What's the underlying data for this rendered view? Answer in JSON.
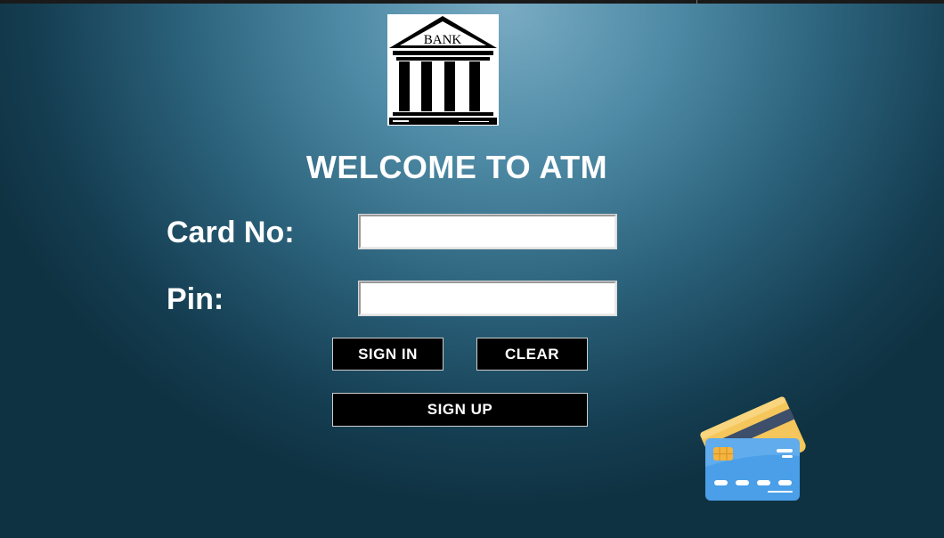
{
  "logo": {
    "text": "BANK"
  },
  "title": "WELCOME TO ATM",
  "form": {
    "card_label": "Card No:",
    "card_value": "",
    "pin_label": "Pin:",
    "pin_value": ""
  },
  "buttons": {
    "sign_in": "SIGN IN",
    "clear": "CLEAR",
    "sign_up": "SIGN UP"
  },
  "colors": {
    "button_bg": "#000000",
    "text": "#ffffff",
    "card_front": "#4a9fe8",
    "card_back": "#f5c65b",
    "card_stripe": "#3d4f6a",
    "chip": "#f4b43f"
  },
  "icons": {
    "logo": "bank-building-icon",
    "cards": "credit-cards-icon"
  }
}
